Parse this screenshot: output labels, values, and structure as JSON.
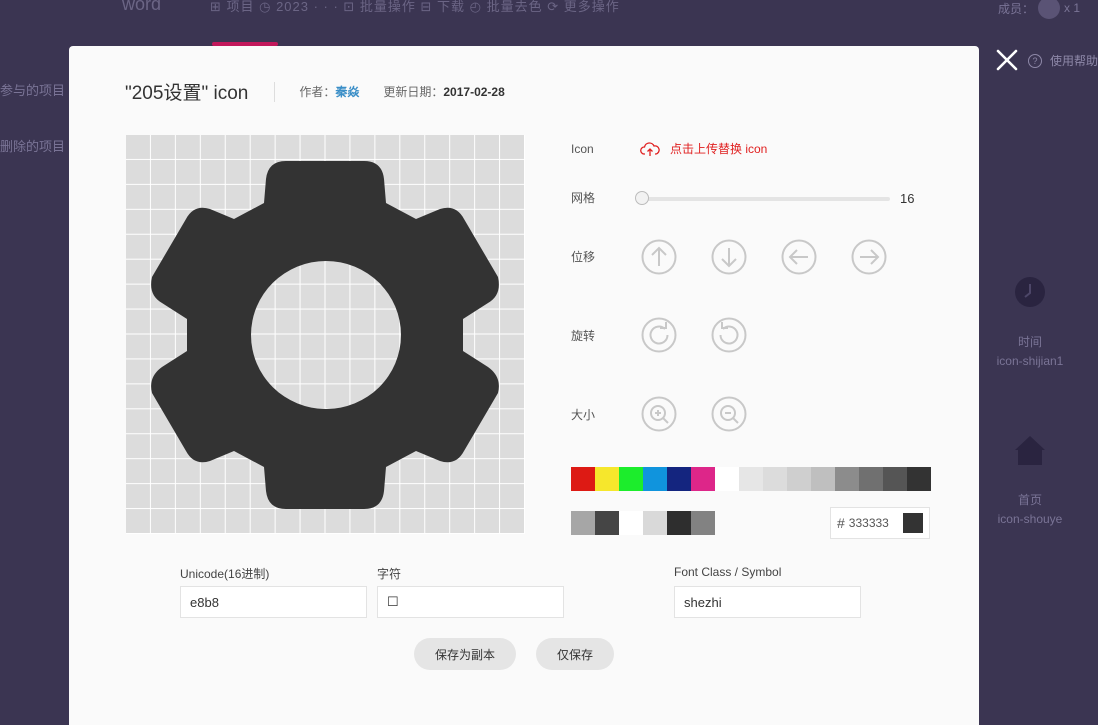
{
  "background": {
    "app_word": "word",
    "tab_strip": "⊞ 项目  ◷ 2023 · · ·   ⊡ 批量操作   ⊟ 下载    ◴ 批量去色    ⟳ 更多操作",
    "side_items": [
      "",
      "参与的项目",
      "删除的项目"
    ],
    "member_label": "成员：",
    "member_count": "x 1",
    "help_label": "使用帮助",
    "cards": [
      {
        "label": "时间",
        "name": "icon-shijian1"
      },
      {
        "label": "首页",
        "name": "icon-shouye"
      }
    ]
  },
  "modal": {
    "title": "\"205设置\" icon",
    "author_label": "作者：",
    "author": "秦焱",
    "date_label": "更新日期：",
    "date": "2017-02-28",
    "icon_label": "Icon",
    "upload_label": "点击上传替换 icon",
    "grid_label": "网格",
    "grid_value": "16",
    "grid_fraction": 0.0,
    "move_label": "位移",
    "rotate_label": "旋转",
    "size_label": "大小",
    "palette_row1": [
      "#dd1a14",
      "#f6e72c",
      "#1ced2c",
      "#1094dd",
      "#14257f",
      "#dd2689",
      "#ffffff",
      "#e6e6e6",
      "#dcdcdc",
      "#cfcfcf",
      "#bfbfbf",
      "#8c8c8c",
      "#707070",
      "#555555",
      "#333333"
    ],
    "palette_row2": [
      "#a6a6a6",
      "#454545",
      "#ffffff",
      "#d9d9d9",
      "#2e2e2e",
      "#828282"
    ],
    "hex_prefix": "#",
    "hex_value": "333333",
    "icon_color": "#333333",
    "fields": {
      "unicode_label": "Unicode(16进制)",
      "unicode_value": "e8b8",
      "char_label": "字符",
      "char_value": "☐",
      "class_label": "Font Class / Symbol",
      "class_value": "shezhi"
    },
    "save_copy_label": "保存为副本",
    "save_only_label": "仅保存"
  }
}
